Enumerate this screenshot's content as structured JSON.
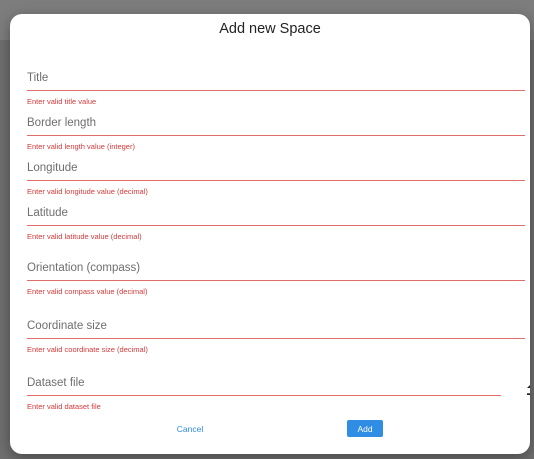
{
  "dialog": {
    "title": "Add new Space"
  },
  "fields": [
    {
      "placeholder": "Title",
      "value": "",
      "error": "Enter valid title value"
    },
    {
      "placeholder": "Border length",
      "value": "",
      "error": "Enter valid length value (integer)"
    },
    {
      "placeholder": "Longitude",
      "value": "",
      "error": "Enter valid longitude value (decimal)"
    },
    {
      "placeholder": "Latitude",
      "value": "",
      "error": "Enter valid latitude value (decimal)"
    },
    {
      "placeholder": "Orientation (compass)",
      "value": "",
      "error": "Enter valid compass value (decimal)"
    },
    {
      "placeholder": "Coordinate size",
      "value": "",
      "error": "Enter valid coordinate size (decimal)"
    },
    {
      "placeholder": "Dataset file",
      "value": "",
      "error": "Enter valid dataset file",
      "icon": "upload-icon"
    }
  ],
  "actions": {
    "cancel_label": "Cancel",
    "add_label": "Add"
  },
  "colors": {
    "accent": "#2f8de4",
    "error": "#d23a3a",
    "error_underline": "#e26b6b",
    "backdrop": "#6f6f6f"
  }
}
